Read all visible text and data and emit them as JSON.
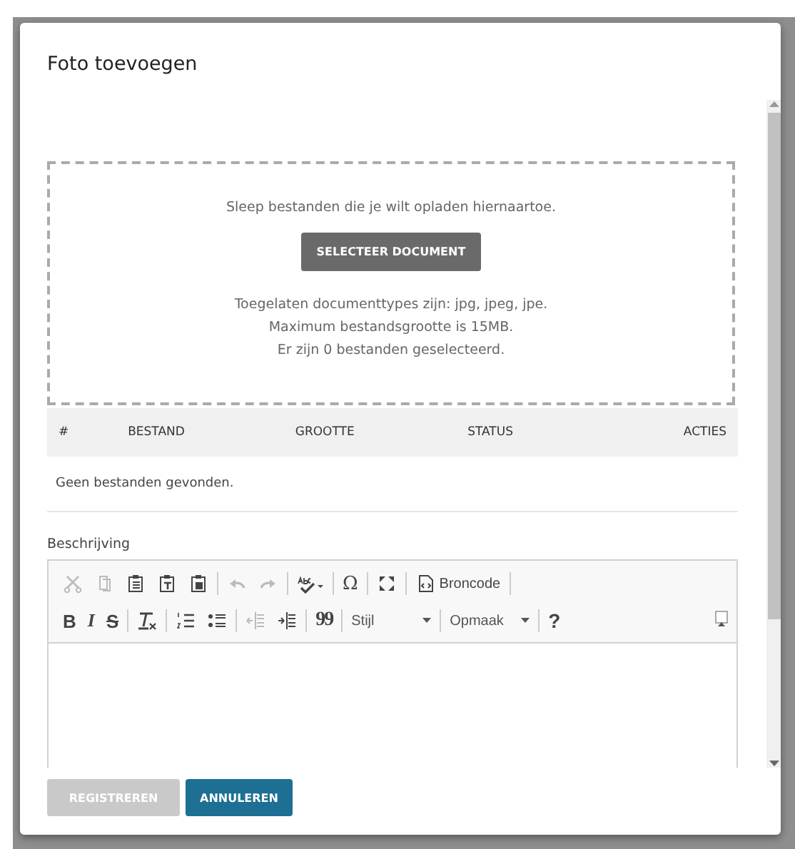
{
  "dialog": {
    "title": "Foto toevoegen"
  },
  "dropzone": {
    "instruction": "Sleep bestanden die je wilt opladen hiernaartoe.",
    "button": "SELECTEER DOCUMENT",
    "notes": [
      "Toegelaten documenttypes zijn: jpg, jpeg, jpe.",
      "Maximum bestandsgrootte is 15MB.",
      "Er zijn 0 bestanden geselecteerd."
    ]
  },
  "table": {
    "columns": [
      "#",
      "BESTAND",
      "GROOTTE",
      "STATUS",
      "ACTIES"
    ],
    "empty_message": "Geen bestanden gevonden."
  },
  "description": {
    "label": "Beschrijving",
    "toolbar_rows": [
      [
        {
          "kind": "cut",
          "disabled": true
        },
        {
          "kind": "copy",
          "disabled": true
        },
        {
          "kind": "paste",
          "disabled": false
        },
        {
          "kind": "pastetext",
          "disabled": false
        },
        {
          "kind": "pasteword",
          "disabled": false
        },
        {
          "kind": "separator"
        },
        {
          "kind": "undo",
          "disabled": true
        },
        {
          "kind": "redo",
          "disabled": true
        },
        {
          "kind": "separator"
        },
        {
          "kind": "spellcheck",
          "disabled": false
        },
        {
          "kind": "separator"
        },
        {
          "kind": "symbol",
          "text": "Ω",
          "disabled": false
        },
        {
          "kind": "separator"
        },
        {
          "kind": "maximize",
          "disabled": false
        },
        {
          "kind": "separator"
        },
        {
          "kind": "source",
          "text": "Broncode",
          "disabled": false
        },
        {
          "kind": "separator"
        }
      ],
      [
        {
          "kind": "bold",
          "text": "B",
          "disabled": false
        },
        {
          "kind": "italic",
          "text": "I",
          "disabled": false
        },
        {
          "kind": "strike",
          "text": "S",
          "disabled": false
        },
        {
          "kind": "separator"
        },
        {
          "kind": "removeformat",
          "disabled": false
        },
        {
          "kind": "separator"
        },
        {
          "kind": "numberedlist",
          "disabled": false
        },
        {
          "kind": "bulletlist",
          "disabled": false
        },
        {
          "kind": "separator"
        },
        {
          "kind": "outdent",
          "disabled": true
        },
        {
          "kind": "indent",
          "disabled": false
        },
        {
          "kind": "separator"
        },
        {
          "kind": "quote",
          "text": "99",
          "disabled": false
        },
        {
          "kind": "separator"
        },
        {
          "kind": "combo",
          "text": "Stijl"
        },
        {
          "kind": "separator"
        },
        {
          "kind": "combo",
          "text": "Opmaak"
        },
        {
          "kind": "separator"
        },
        {
          "kind": "help",
          "text": "?",
          "disabled": false
        }
      ]
    ]
  },
  "buttons": [
    {
      "label": "REGISTREREN",
      "disabled": true
    },
    {
      "label": "ANNULEREN",
      "disabled": false
    }
  ]
}
